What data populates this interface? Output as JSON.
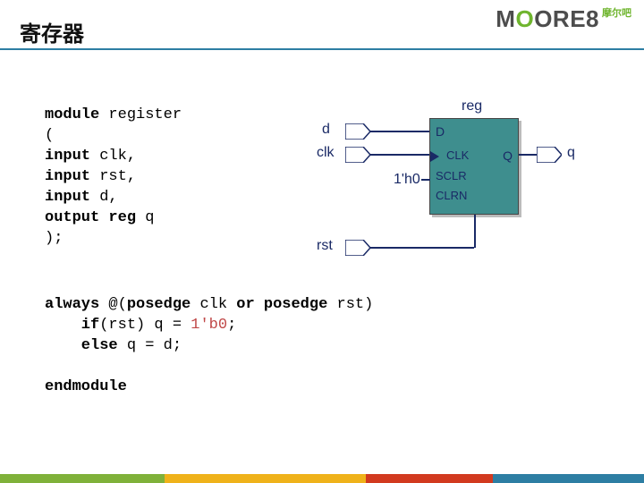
{
  "header": {
    "title": "寄存器",
    "logo_pre": "M",
    "logo_green": "O",
    "logo_post": "ORE8",
    "logo_tag": "摩尔吧"
  },
  "code": {
    "line1_kw": "module",
    "line1_rest": " register",
    "line2": "(",
    "line3_kw": "input",
    "line3_rest": " clk,",
    "line4_kw": "input",
    "line4_rest": " rst,",
    "line5_kw": "input",
    "line5_rest": " d,",
    "line6_kw1": "output",
    "line6_kw2": " reg",
    "line6_rest": " q",
    "line7": ");"
  },
  "code2": {
    "l1a": "always",
    "l1b": " @(",
    "l1c": "posedge",
    "l1d": " clk ",
    "l1e": "or",
    "l1f": " ",
    "l1g": "posedge",
    "l1h": " rst)",
    "l2a": "    if",
    "l2b": "(rst) q = ",
    "l2c": "1'b0",
    "l2d": ";",
    "l3a": "    else",
    "l3b": " q = d;",
    "l4": "",
    "l5": "endmodule"
  },
  "diagram": {
    "title": "reg",
    "port_d": "D",
    "port_clk": "CLK",
    "port_sclr": "SCLR",
    "port_clrn": "CLRN",
    "port_q": "Q",
    "ext_d": "d",
    "ext_clk": "clk",
    "ext_rst": "rst",
    "ext_q": "q",
    "const": "1'h0"
  }
}
